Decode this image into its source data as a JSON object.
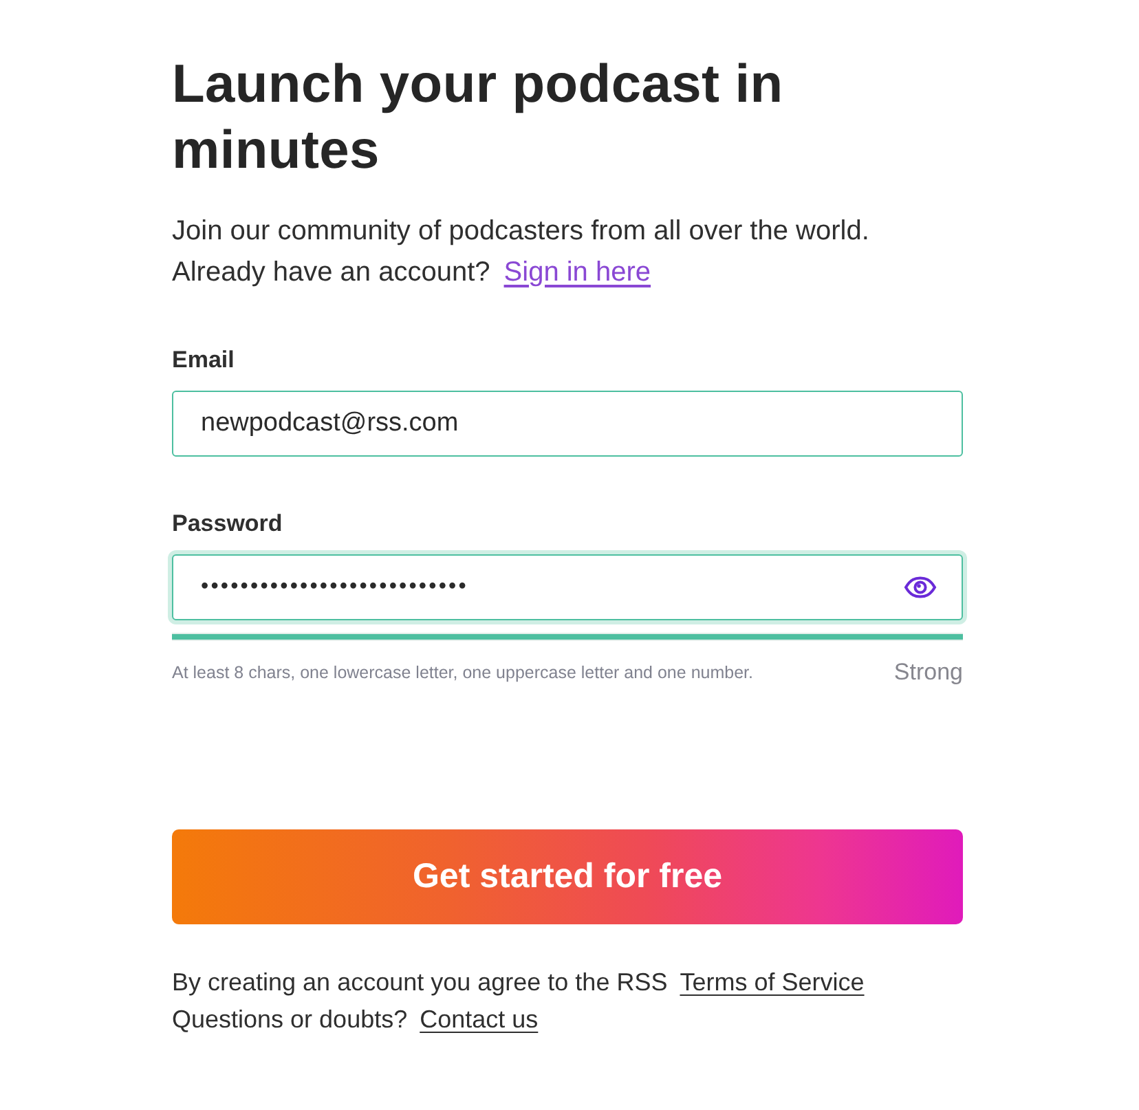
{
  "heading": "Launch your podcast in minutes",
  "intro": {
    "text": "Join our community of podcasters from all over the world.",
    "prompt": "Already have an account?",
    "link": "Sign in here"
  },
  "fields": [
    {
      "kind": "email",
      "label": "Email",
      "value": "newpodcast@rss.com",
      "focused": false
    },
    {
      "kind": "password",
      "label": "Password",
      "value": "•••••••••••••••••••••••••••",
      "focused": true,
      "strength": {
        "level": 1,
        "reading": "Strong",
        "hint": "At least 8 chars, one lowercase letter, one uppercase letter and one number."
      }
    }
  ],
  "submit": "Get started for free",
  "footer": [
    {
      "text": "By creating an account you agree to the RSS",
      "link": "Terms of Service"
    },
    {
      "text": "Questions or doubts?",
      "link": "Contact us"
    }
  ]
}
